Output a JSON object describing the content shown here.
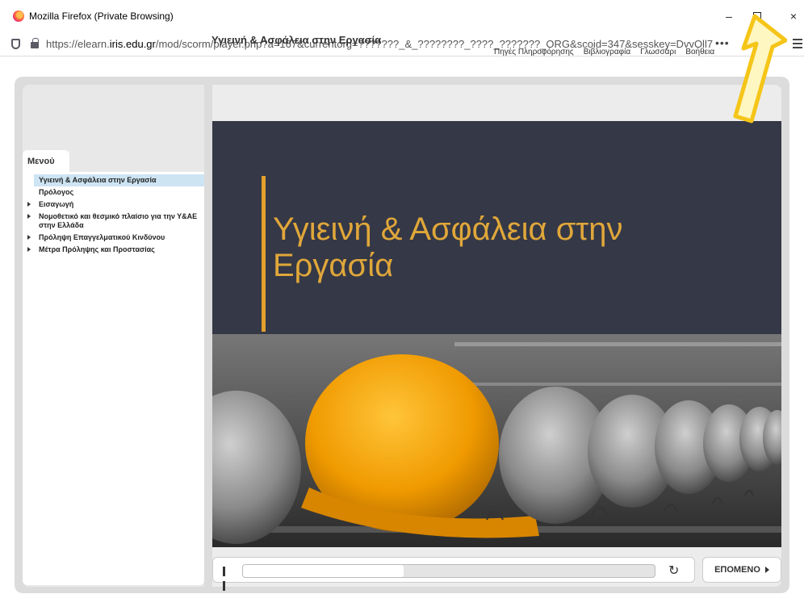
{
  "window": {
    "title": "Mozilla Firefox (Private Browsing)",
    "minimize": "–",
    "close": "×"
  },
  "urlbar": {
    "prefix": "https://elearn.",
    "domain": "iris.edu.gr",
    "rest": "/mod/scorm/player.php?a=167&currentorg=???????_&_????????_????_???????_ORG&scoid=347&sesskey=DvvOll7",
    "more": "•••"
  },
  "course": {
    "title": "Υγιεινή & Ασφάλεια στην Εργασία",
    "topnav": [
      "Πηγές Πληροφόρησης",
      "Βιβλιογραφία",
      "Γλωσσάρι",
      "Βοήθεια"
    ]
  },
  "menu": {
    "tab": "Μενού",
    "items": [
      {
        "label": "Υγιεινή & Ασφάλεια στην Εργασία",
        "active": true,
        "arrow": false
      },
      {
        "label": "Πρόλογος",
        "active": false,
        "arrow": false
      },
      {
        "label": "Εισαγωγή",
        "active": false,
        "arrow": true
      },
      {
        "label": "Νομοθετικό και θεσμικό πλαίσιο για την Υ&ΑΕ στην Ελλάδα",
        "active": false,
        "arrow": true
      },
      {
        "label": "Πρόληψη Επαγγελματικού Κινδύνου",
        "active": false,
        "arrow": true
      },
      {
        "label": "Μέτρα Πρόληψης και Προστασίας",
        "active": false,
        "arrow": true
      }
    ]
  },
  "slide": {
    "title_line1": "Υγιεινή & Ασφάλεια στην",
    "title_line2": "Εργασία",
    "accent": "#e0a73a",
    "background": "#353846",
    "hat_colors": [
      "#f0a500",
      "#8e8e8e"
    ]
  },
  "player": {
    "progress": 0.39,
    "next_label": "ΕΠΟΜΕΝΟ",
    "replay_icon": "↻"
  },
  "annotation": {
    "arrow_color": "#f5c518"
  }
}
